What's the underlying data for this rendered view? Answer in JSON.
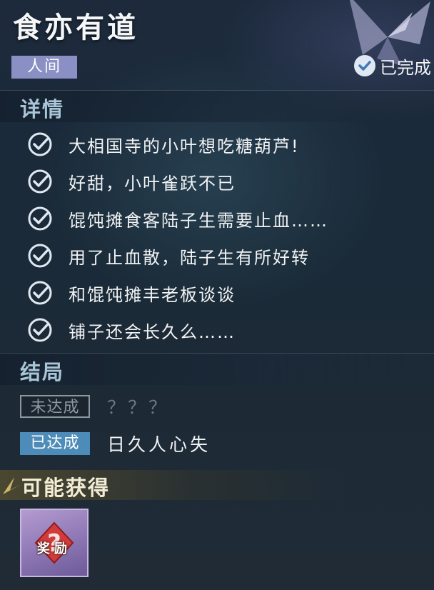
{
  "quest": {
    "title": "食亦有道",
    "realm_tag": "人间",
    "status_label": "已完成"
  },
  "details": {
    "section_title": "详情",
    "tasks": [
      {
        "text": "大相国寺的小叶想吃糖葫芦!",
        "done": true
      },
      {
        "text": "好甜，小叶雀跃不已",
        "done": true
      },
      {
        "text": "馄饨摊食客陆子生需要止血……",
        "done": true
      },
      {
        "text": "用了止血散，陆子生有所好转",
        "done": true
      },
      {
        "text": "和馄饨摊丰老板谈谈",
        "done": true
      },
      {
        "text": "铺子还会长久么……",
        "done": true
      }
    ]
  },
  "endings": {
    "section_title": "结局",
    "items": [
      {
        "badge": "未达成",
        "value": "？？？",
        "achieved": false
      },
      {
        "badge": "已达成",
        "value": "日久人心失",
        "achieved": true
      }
    ]
  },
  "rewards": {
    "section_title": "可能获得",
    "items": [
      {
        "label": "奖励",
        "icon": "question-mark-icon"
      }
    ]
  },
  "colors": {
    "realm_tag_bg": "#8a8fc4",
    "section_title": "#a8c6d8",
    "achieved_badge": "#4d8cb8",
    "reward_item_bg": "#8d76b4"
  }
}
